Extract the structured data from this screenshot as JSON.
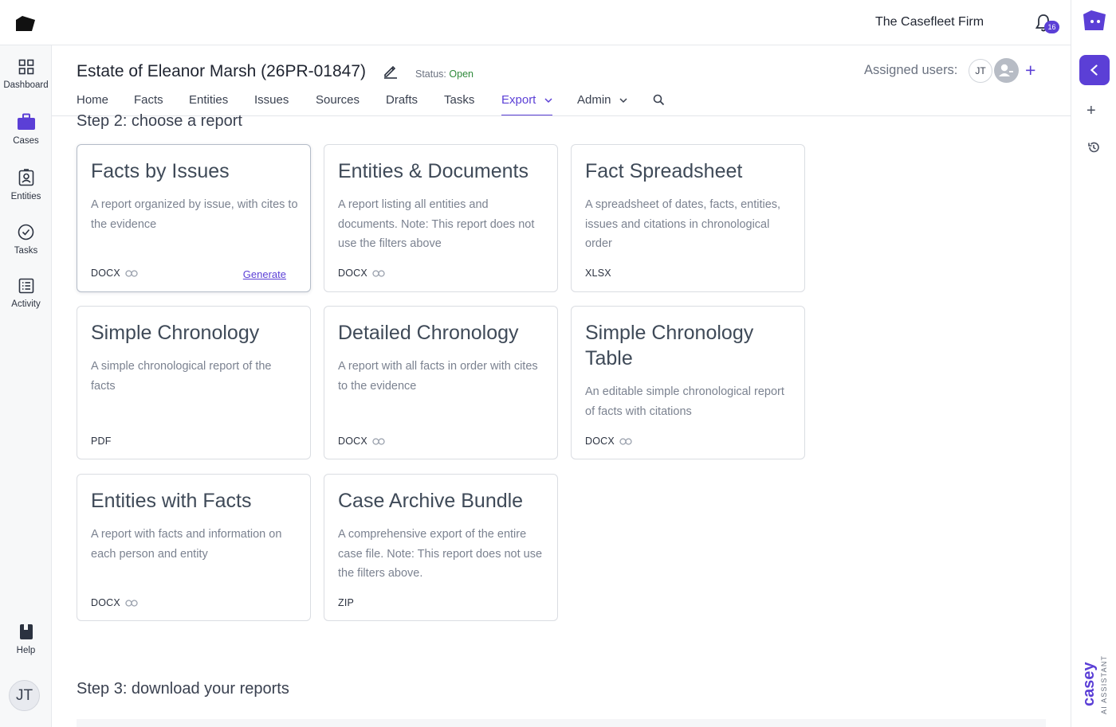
{
  "header": {
    "firm_name": "The Casefleet Firm",
    "notification_count": "16"
  },
  "sidebar": {
    "items": [
      {
        "label": "Dashboard",
        "icon": "grid-icon"
      },
      {
        "label": "Cases",
        "icon": "briefcase-icon"
      },
      {
        "label": "Entities",
        "icon": "contact-card-icon"
      },
      {
        "label": "Tasks",
        "icon": "check-circle-icon"
      },
      {
        "label": "Activity",
        "icon": "list-icon"
      },
      {
        "label": "Help",
        "icon": "book-icon"
      }
    ],
    "user_initials": "JT"
  },
  "case": {
    "title": "Estate of Eleanor Marsh (26PR-01847)",
    "status_label": "Status:",
    "status_value": "Open",
    "assigned_label": "Assigned users:",
    "assigned_user_initials": "JT"
  },
  "tabs": [
    {
      "label": "Home"
    },
    {
      "label": "Facts"
    },
    {
      "label": "Entities"
    },
    {
      "label": "Issues"
    },
    {
      "label": "Sources"
    },
    {
      "label": "Drafts"
    },
    {
      "label": "Tasks"
    },
    {
      "label": "Export",
      "active": true
    },
    {
      "label": "Admin"
    }
  ],
  "step2_title": "Step 2: choose a report",
  "step3_title": "Step 3: download your reports",
  "reports": [
    {
      "title": "Facts by Issues",
      "description": "A report organized by issue, with cites to the evidence",
      "format": "DOCX",
      "has_link": true,
      "action": "Generate"
    },
    {
      "title": "Entities & Documents",
      "description": "A report listing all entities and documents. Note: This report does not use the filters above",
      "format": "DOCX",
      "has_link": true
    },
    {
      "title": "Fact Spreadsheet",
      "description": "A spreadsheet of dates, facts, entities, issues and citations in chronological order",
      "format": "XLSX",
      "has_link": false
    },
    {
      "title": "Simple Chronology",
      "description": "A simple chronological report of the facts",
      "format": "PDF",
      "has_link": false
    },
    {
      "title": "Detailed Chronology",
      "description": "A report with all facts in order with cites to the evidence",
      "format": "DOCX",
      "has_link": true
    },
    {
      "title": "Simple Chronology Table",
      "description": "An editable simple chronological report of facts with citations",
      "format": "DOCX",
      "has_link": true
    },
    {
      "title": "Entities with Facts",
      "description": "A report with facts and information on each person and entity",
      "format": "DOCX",
      "has_link": true
    },
    {
      "title": "Case Archive Bundle",
      "description": "A comprehensive export of the entire case file. Note: This report does not use the filters above.",
      "format": "ZIP",
      "has_link": false
    }
  ],
  "assistant": {
    "name": "casey",
    "tagline": "AI ASSISTANT"
  },
  "colors": {
    "accent": "#5b3fd6",
    "status_open": "#2f8a3b"
  }
}
